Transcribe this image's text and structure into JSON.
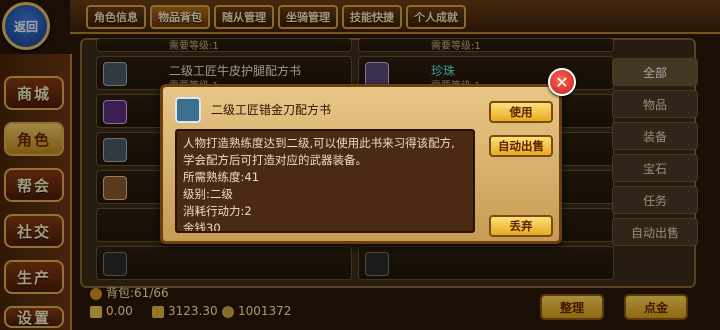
{
  "back_label": "返回",
  "tabs": [
    "角色信息",
    "物品背包",
    "随从管理",
    "坐骑管理",
    "技能快捷",
    "个人成就"
  ],
  "left_nav": [
    "商城",
    "角色",
    "帮会",
    "社交",
    "生产",
    "设置"
  ],
  "slots": [
    {
      "name": "需要等级:1",
      "req": ""
    },
    {
      "name": "需要等级:1",
      "req": ""
    },
    {
      "name": "二级工匠牛皮护腿配方书",
      "req": "需要等级:1"
    },
    {
      "name": "珍珠",
      "req": "需要等级:1"
    }
  ],
  "categories": [
    "全部",
    "物品",
    "装备",
    "宝石",
    "任务",
    "自动出售"
  ],
  "bag_label": "背包:61/66",
  "gold_a": "0.00",
  "gold_b": "3123.30",
  "gold_c": "1001372",
  "btn_sort": "整理",
  "btn_shop": "点金",
  "dialog": {
    "title": "二级工匠错金刀配方书",
    "body": [
      "人物打造熟练度达到二级,可以使用此书来习得该配方,",
      "学会配方后可打造对应的武器装备。",
      "所需熟练度:41",
      "级别:二级",
      "消耗行动力:2",
      "金钱30"
    ],
    "btn_use": "使用",
    "btn_auto": "自动出售",
    "btn_discard": "丢弃",
    "close": "✕"
  }
}
